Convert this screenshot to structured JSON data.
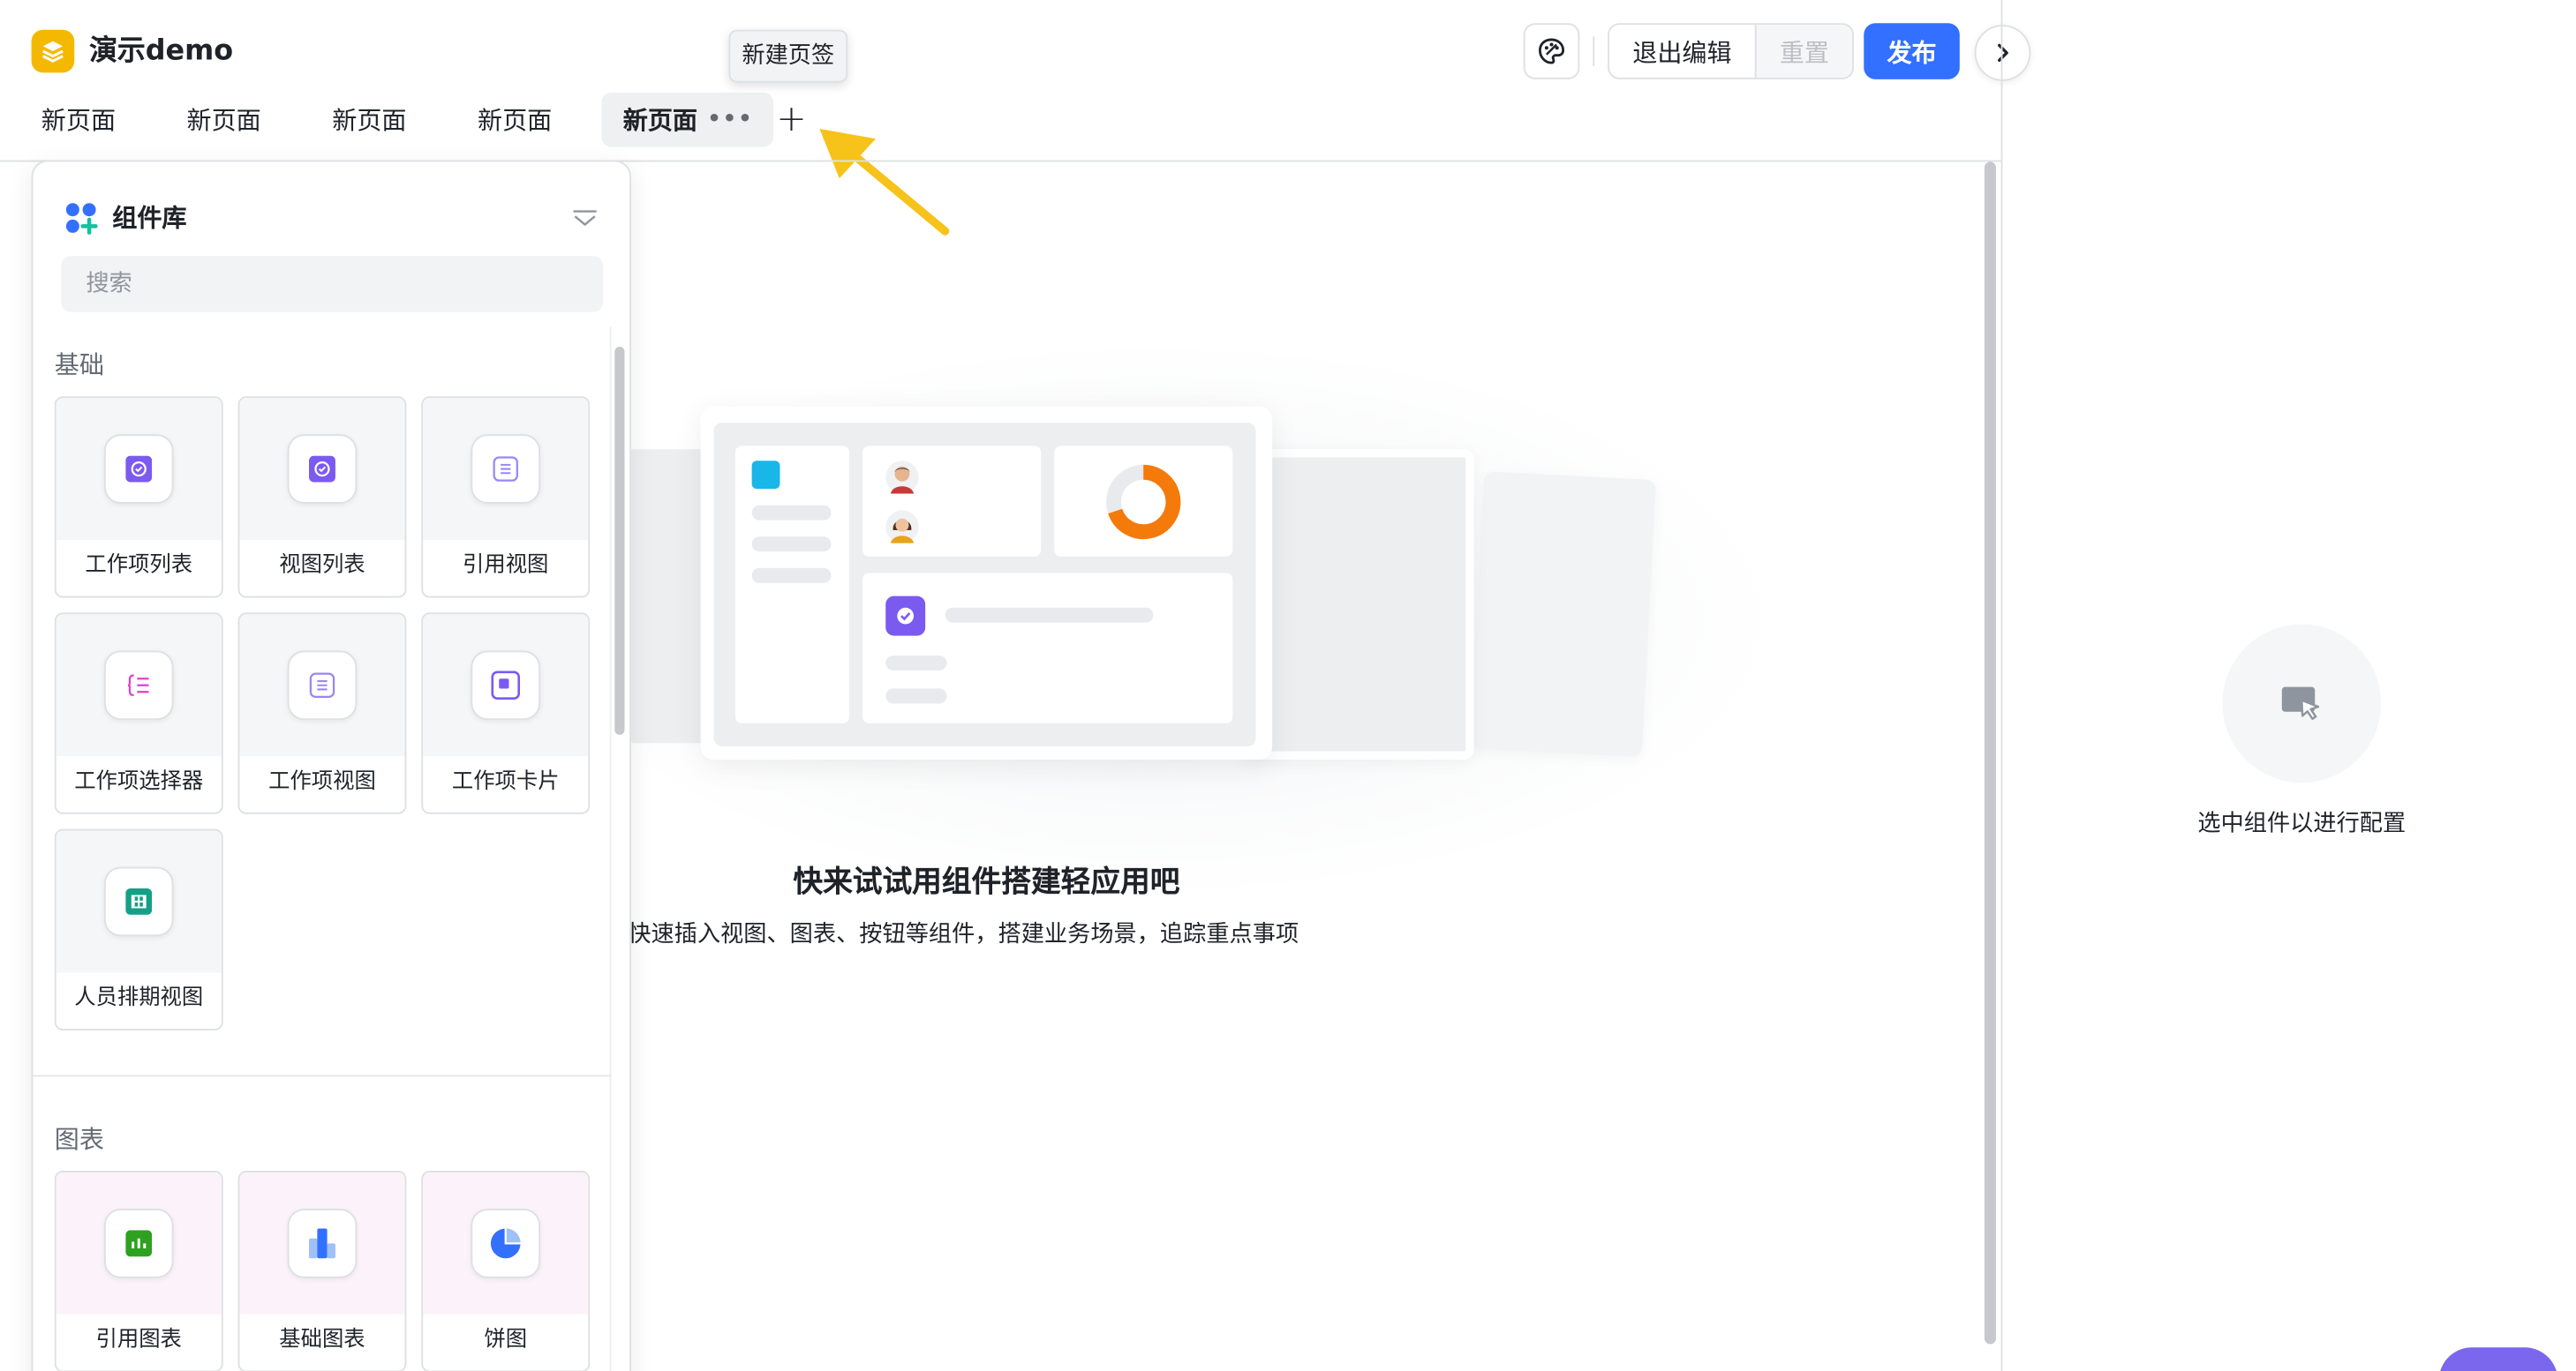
{
  "app": {
    "title": "演示demo"
  },
  "tabs": [
    {
      "label": "新页面",
      "active": false
    },
    {
      "label": "新页面",
      "active": false
    },
    {
      "label": "新页面",
      "active": false
    },
    {
      "label": "新页面",
      "active": false
    },
    {
      "label": "新页面",
      "active": true,
      "more": "•••"
    }
  ],
  "add_tab": {
    "symbol": "+",
    "tooltip": "新建页签"
  },
  "toolbar": {
    "exit_edit_label": "退出编辑",
    "reset_label": "重置",
    "publish_label": "发布"
  },
  "component_library": {
    "title": "组件库",
    "search_placeholder": "搜索",
    "sections": [
      {
        "label": "基础",
        "items": [
          {
            "label": "工作项列表",
            "icon": "check-circle-icon"
          },
          {
            "label": "视图列表",
            "icon": "check-circle-icon"
          },
          {
            "label": "引用视图",
            "icon": "list-doc-icon"
          },
          {
            "label": "工作项选择器",
            "icon": "selector-list-icon"
          },
          {
            "label": "工作项视图",
            "icon": "list-doc-icon"
          },
          {
            "label": "工作项卡片",
            "icon": "card-square-icon"
          },
          {
            "label": "人员排期视图",
            "icon": "calendar-grid-icon"
          }
        ]
      },
      {
        "label": "图表",
        "items": [
          {
            "label": "引用图表",
            "icon": "bar-chart-icon"
          },
          {
            "label": "基础图表",
            "icon": "column-chart-icon"
          },
          {
            "label": "饼图",
            "icon": "pie-chart-icon"
          }
        ]
      }
    ]
  },
  "canvas": {
    "empty_title": "快来试试用组件搭建轻应用吧",
    "empty_desc": "快速插入视图、图表、按钮等组件，搭建业务场景，追踪重点事项"
  },
  "config_panel": {
    "hint": "选中组件以进行配置"
  },
  "colors": {
    "primary": "#3370ff",
    "logo": "#f5b800",
    "arrow": "#f7c21a",
    "purple": "#7b5af0",
    "green": "#2ea121",
    "teal": "#14a085",
    "pink": "#e040c8"
  }
}
